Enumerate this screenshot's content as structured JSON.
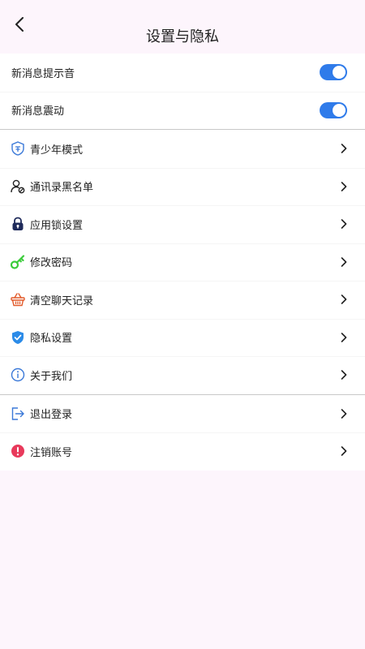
{
  "header": {
    "title": "设置与隐私"
  },
  "notifications": [
    {
      "label": "新消息提示音",
      "enabled": true
    },
    {
      "label": "新消息震动",
      "enabled": true
    }
  ],
  "menu": [
    {
      "label": "青少年模式",
      "icon": "youth-shield-icon"
    },
    {
      "label": "通讯录黑名单",
      "icon": "user-block-icon"
    },
    {
      "label": "应用锁设置",
      "icon": "lock-icon"
    },
    {
      "label": "修改密码",
      "icon": "key-icon"
    },
    {
      "label": "清空聊天记录",
      "icon": "basket-icon"
    },
    {
      "label": "隐私设置",
      "icon": "shield-check-icon"
    },
    {
      "label": "关于我们",
      "icon": "info-icon"
    }
  ],
  "account": [
    {
      "label": "退出登录",
      "icon": "logout-icon"
    },
    {
      "label": "注销账号",
      "icon": "alert-icon"
    }
  ],
  "colors": {
    "accent": "#2f7bea",
    "background": "#fdf5fc",
    "key": "#3ccc3c",
    "alert": "#e8395b",
    "lock": "#1e2a5a",
    "basket": "#e25b2b"
  }
}
